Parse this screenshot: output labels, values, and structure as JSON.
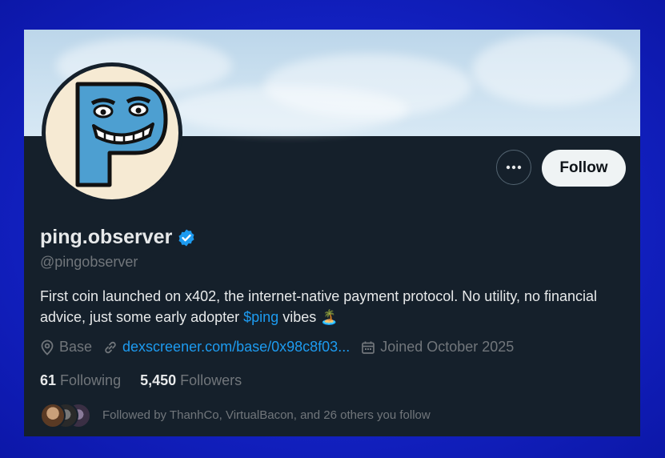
{
  "profile": {
    "display_name": "ping.observer",
    "handle": "@pingobserver",
    "bio_part1": "First coin launched on x402, the internet-native payment protocol. No utility, no financial advice, just some early adopter ",
    "bio_cashtag": "$ping",
    "bio_part2": " vibes",
    "bio_emoji": "🏝️",
    "location": "Base",
    "website": "dexscreener.com/base/0x98c8f03...",
    "joined": "Joined October 2025"
  },
  "stats": {
    "following_count": "61",
    "following_label": "Following",
    "followers_count": "5,450",
    "followers_label": "Followers"
  },
  "followed_by": "Followed by ThanhCo, VirtualBacon, and 26 others you follow",
  "actions": {
    "follow_label": "Follow",
    "more_icon": "more-horizontal-icon"
  },
  "colors": {
    "accent": "#1d9bf0",
    "card_bg": "#15202b",
    "page_bg": "#1322c4"
  }
}
